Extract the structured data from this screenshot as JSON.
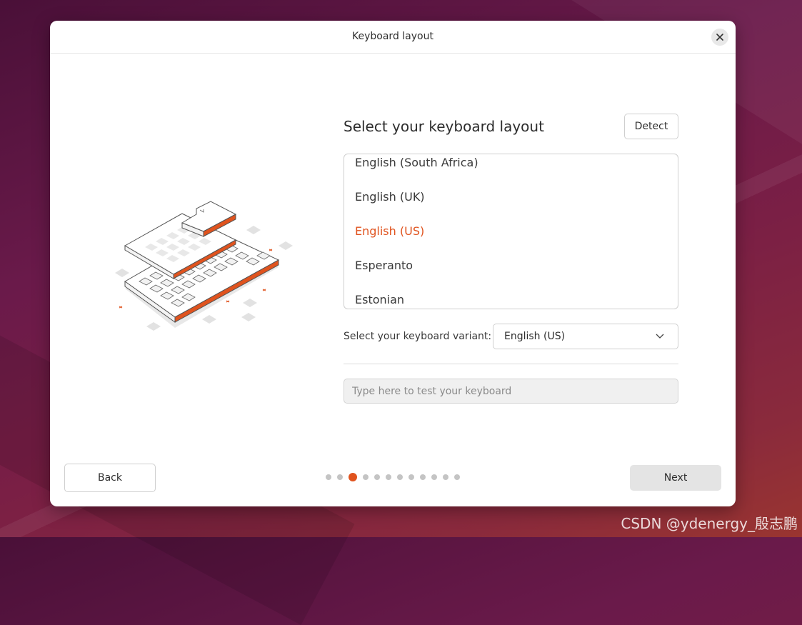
{
  "window": {
    "title": "Keyboard layout",
    "close_icon": "close-icon"
  },
  "main": {
    "heading": "Select your keyboard layout",
    "detect_label": "Detect",
    "layouts": [
      {
        "label": "English (South Africa)",
        "selected": false
      },
      {
        "label": "English (UK)",
        "selected": false
      },
      {
        "label": "English (US)",
        "selected": true
      },
      {
        "label": "Esperanto",
        "selected": false
      },
      {
        "label": "Estonian",
        "selected": false
      }
    ],
    "variant_label": "Select your keyboard variant:",
    "variant_value": "English (US)",
    "test_placeholder": "Type here to test your keyboard"
  },
  "footer": {
    "back_label": "Back",
    "next_label": "Next",
    "progress": {
      "total": 12,
      "current": 3
    }
  },
  "colors": {
    "accent": "#e0531e",
    "dot_inactive": "#c4c4c4"
  },
  "watermark": "CSDN @ydenergy_殷志鹏"
}
